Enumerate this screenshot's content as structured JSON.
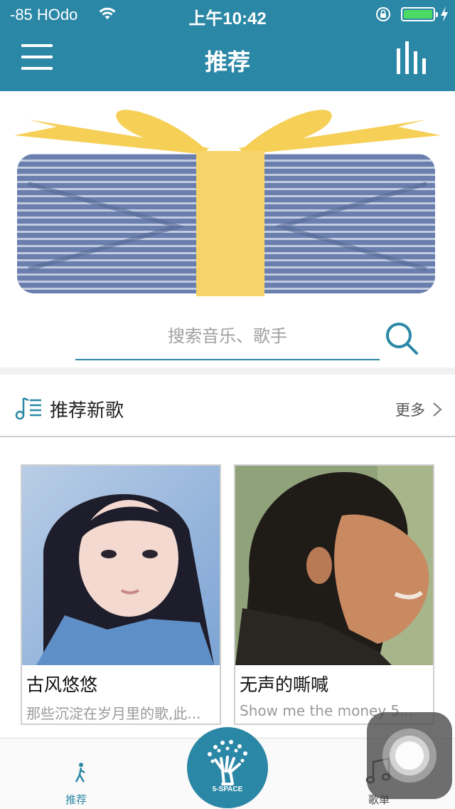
{
  "status_bar": {
    "carrier": "-85 HOdo",
    "time": "上午10:42",
    "icons": [
      "wifi-icon",
      "rotation-lock-icon",
      "battery-icon",
      "charging-bolt-icon"
    ],
    "battery_color": "#4cd964"
  },
  "nav": {
    "title": "推荐",
    "left_icon": "menu-icon",
    "right_icon": "equalizer-icon",
    "background": "#2b87a6"
  },
  "banner": {
    "icon": "gift-box-icon"
  },
  "search": {
    "value": "",
    "placeholder": "搜索音乐、歌手",
    "icon": "search-icon"
  },
  "section": {
    "title": "推荐新歌",
    "more_label": "更多",
    "icon": "music-list-icon"
  },
  "songs": [
    {
      "title": "古风悠悠",
      "subtitle": "那些沉淀在岁月里的歌,此..."
    },
    {
      "title": "无声的嘶喊",
      "subtitle": "Show me the money 5..."
    }
  ],
  "tab_bar": {
    "tabs": [
      {
        "label": "推荐",
        "icon": "recommend-icon",
        "active": true
      },
      {
        "label": "歌单",
        "icon": "music-note-icon",
        "active": false
      }
    ],
    "center_label": "5-SPACE",
    "center_icon": "hand-tree-logo-icon",
    "active_color": "#2b87a6"
  }
}
